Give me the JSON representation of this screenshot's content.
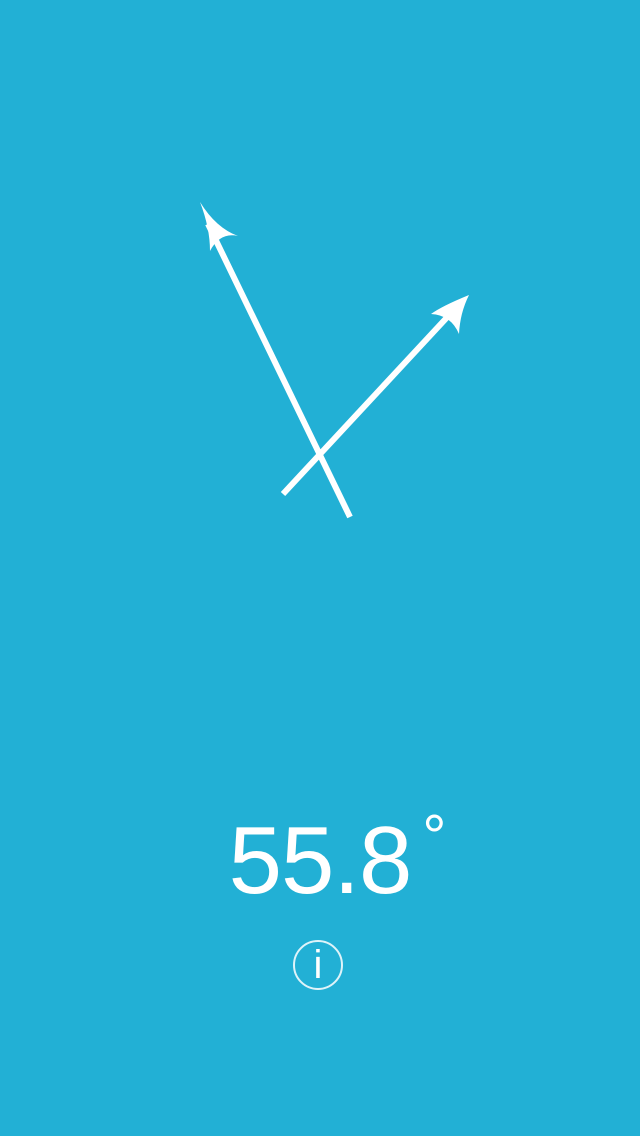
{
  "protractor": {
    "angle_value": "55.8",
    "degree_symbol": "°",
    "arrow_color": "#FFFFFF",
    "background_color": "#22B0D5"
  },
  "info_button": {
    "icon": "info-icon",
    "glyph": "i"
  }
}
